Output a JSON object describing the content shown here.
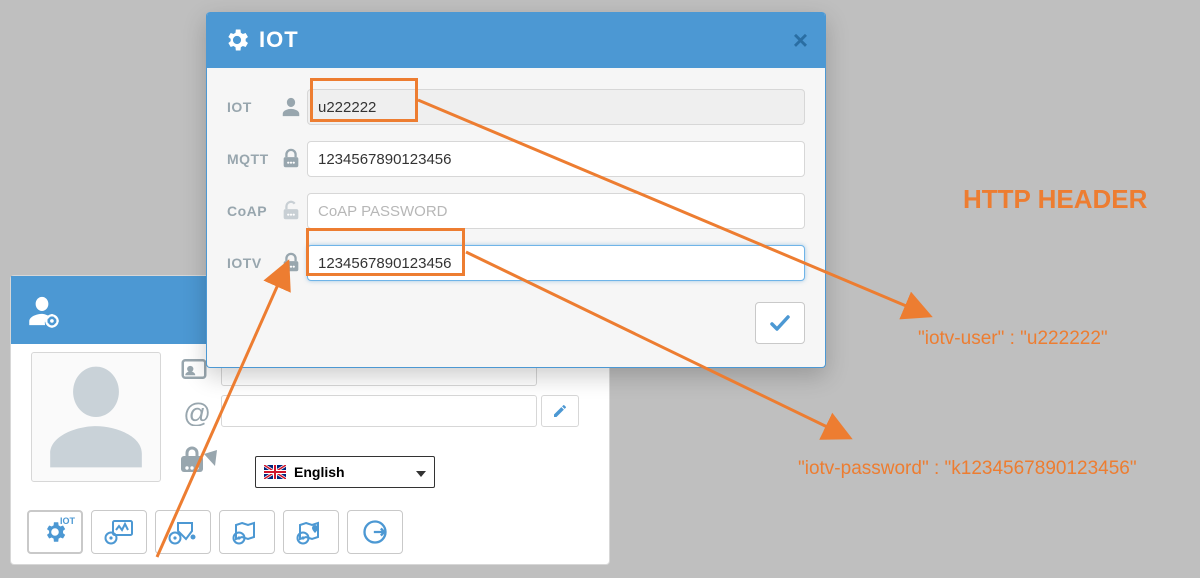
{
  "profile": {
    "language_label": "English",
    "toolbar_sup": "IOT"
  },
  "modal": {
    "title": "IOT",
    "fields": {
      "iot": {
        "label": "IOT",
        "value": "u222222"
      },
      "mqtt": {
        "label": "MQTT",
        "value": "1234567890123456"
      },
      "coap": {
        "label": "CoAP",
        "placeholder": "CoAP PASSWORD"
      },
      "iotv": {
        "label": "IOTV",
        "value": "1234567890123456"
      }
    }
  },
  "annotation": {
    "title": "HTTP HEADER",
    "line1": "\"iotv-user\" : \"u222222\"",
    "line2": "\"iotv-password\" : \"k1234567890123456\""
  },
  "colors": {
    "primary": "#4c98d3",
    "accent": "#ed7d31",
    "label": "#98a6ae"
  }
}
